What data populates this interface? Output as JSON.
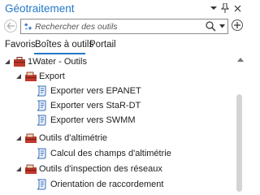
{
  "pane": {
    "title": "Géotraitement"
  },
  "window_buttons": {
    "options": "options-dropdown",
    "pin": "pin-icon",
    "close": "close-icon"
  },
  "search": {
    "placeholder": "Rechercher des outils"
  },
  "tabs": [
    {
      "label": "Favoris",
      "active": false
    },
    {
      "label": "Boîtes à outils",
      "active": true
    },
    {
      "label": "Portail",
      "active": false
    }
  ],
  "tree": {
    "root": {
      "label": "1Water - Outils",
      "expanded": true
    },
    "groups": [
      {
        "label": "Export",
        "expanded": true,
        "tools": [
          "Exporter vers EPANET",
          "Exporter vers StaR-DT",
          "Exporter vers SWMM"
        ]
      },
      {
        "label": "Outils d'altimétrie",
        "expanded": true,
        "tools": [
          "Calcul des champs d'altimétrie"
        ]
      },
      {
        "label": "Outils d'inspection des réseaux",
        "expanded": true,
        "tools": [
          "Orientation de raccordement"
        ]
      }
    ]
  },
  "colors": {
    "accent": "#2479c8",
    "toolbox_red": "#c0392b",
    "script_blue": "#3a6fb5"
  }
}
